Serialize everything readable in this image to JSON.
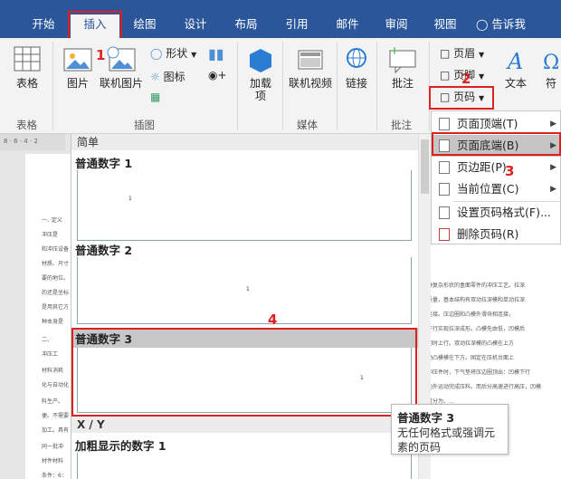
{
  "ribbon_tabs": [
    {
      "label": "开始"
    },
    {
      "label": "插入"
    },
    {
      "label": "绘图"
    },
    {
      "label": "设计"
    },
    {
      "label": "布局"
    },
    {
      "label": "引用"
    },
    {
      "label": "邮件"
    },
    {
      "label": "审阅"
    },
    {
      "label": "视图"
    }
  ],
  "tell_me": "告诉我",
  "ribbon": {
    "table": "表格",
    "picture": "图片",
    "online_picture": "联机图片",
    "shapes": "形状",
    "icons": "图标",
    "addins": "加载\n项",
    "online_video": "联机视频",
    "link": "链接",
    "comment": "批注",
    "header": "页眉",
    "footer": "页脚",
    "page_number": "页码",
    "text": "文本",
    "symbol": "符",
    "groups": {
      "table": "表格",
      "illustrations": "插图",
      "media": "媒体",
      "comments": "批注",
      "header_footer": "页"
    }
  },
  "annotations": {
    "n1": "1",
    "n2": "2",
    "n3": "3",
    "n4": "4"
  },
  "gallery": {
    "section_simple": "简单",
    "items": [
      {
        "title": "普通数字 1",
        "num": "1"
      },
      {
        "title": "普通数字 2",
        "num": "1"
      },
      {
        "title": "普通数字 3",
        "num": "1"
      }
    ],
    "section_xy": "X / Y",
    "bold_title": "加粗显示的数字 1"
  },
  "menu": {
    "items": [
      {
        "label": "页面顶端(T)"
      },
      {
        "label": "页面底端(B)"
      },
      {
        "label": "页边距(P)"
      },
      {
        "label": "当前位置(C)"
      },
      {
        "label": "设置页码格式(F)..."
      },
      {
        "label": "删除页码(R)"
      }
    ]
  },
  "tooltip": {
    "title": "普通数字 3",
    "desc": "无任何格式或强调元素的页码"
  },
  "document": {
    "ruler": "8 · 6 · 4 · 2",
    "lines_left": [
      "一、·定义",
      "冲压是",
      "和冲压设备",
      "材质、尺寸",
      "要的地位。",
      "的还是坐标",
      "是用其它方",
      "种本身是",
      "二、·",
      "冲压工",
      "材料消耗",
      "化与自动化",
      "料生产。",
      "便。不需要",
      "加工。具有",
      "同一批冲",
      "材件材料",
      "条件：6："
    ],
    "lines_right": [
      "种复杂形状的盒面零件的冲压工艺。拉深",
      "质量，基本结构有双动拉深模和单动拉深",
      "连接。压边圈和凸模外滑块相连接，",
      "下行实现拉深成形。凸模先由低，凹模后",
      "同时上行。双动拉深模的凸模在上方",
      "动凸模模在下方。固定在压机台面上",
      "冲压件时，下气垫将压边圈顶出：凹模下行",
      "向外运动完成压料。而后分高速进行高压，凹模",
      "可分为、…"
    ]
  }
}
